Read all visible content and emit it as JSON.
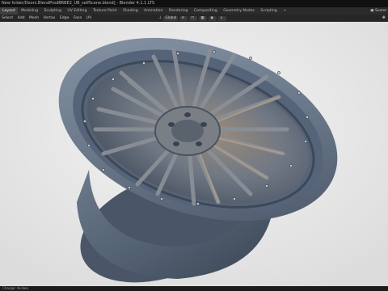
{
  "window": {
    "title": "New folder/Doors.BlendProdBRBE2_UB_selfScene.blend] - Blender 4.1.1 LTS"
  },
  "workspaces": {
    "items": [
      "Layout",
      "Modeling",
      "Sculpting",
      "UV Editing",
      "Texture Paint",
      "Shading",
      "Animation",
      "Rendering",
      "Compositing",
      "Geometry Nodes",
      "Scripting",
      "+"
    ],
    "active_index": 0,
    "right_label": "Scene"
  },
  "header": {
    "menus": [
      "Select",
      "Add",
      "Mesh",
      "Vertex",
      "Edge",
      "Face",
      "UV"
    ],
    "transform_orientation": "Global"
  },
  "status": {
    "text": "Change: 4e-bea"
  },
  "colors": {
    "rim": "#5f6e80",
    "rim_dark": "#3a4554",
    "spoke": "#7a7f86",
    "viewport_bg": "#eaeaea"
  }
}
